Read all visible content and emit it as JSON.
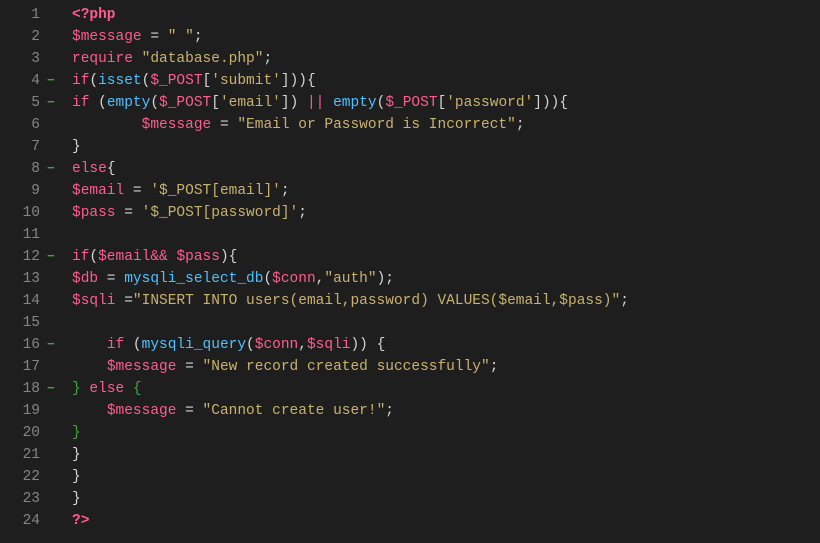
{
  "lines": [
    {
      "n": "1",
      "fold": "",
      "tokens": [
        {
          "c": "t-tag",
          "t": "<?php"
        }
      ]
    },
    {
      "n": "2",
      "fold": "",
      "tokens": [
        {
          "c": "t-var",
          "t": "$message"
        },
        {
          "c": "t-op",
          "t": " = "
        },
        {
          "c": "t-str",
          "t": "\" \""
        },
        {
          "c": "t-punc",
          "t": ";"
        }
      ]
    },
    {
      "n": "3",
      "fold": "",
      "tokens": [
        {
          "c": "t-kw",
          "t": "require"
        },
        {
          "c": "t-op",
          "t": " "
        },
        {
          "c": "t-str",
          "t": "\"database.php\""
        },
        {
          "c": "t-punc",
          "t": ";"
        }
      ]
    },
    {
      "n": "4",
      "fold": "−",
      "tokens": [
        {
          "c": "t-kw",
          "t": "if"
        },
        {
          "c": "t-punc",
          "t": "("
        },
        {
          "c": "t-fn",
          "t": "isset"
        },
        {
          "c": "t-punc",
          "t": "("
        },
        {
          "c": "t-var",
          "t": "$_POST"
        },
        {
          "c": "t-punc",
          "t": "["
        },
        {
          "c": "t-str",
          "t": "'submit'"
        },
        {
          "c": "t-punc",
          "t": "])){"
        }
      ]
    },
    {
      "n": "5",
      "fold": "−",
      "tokens": [
        {
          "c": "t-kw",
          "t": "if"
        },
        {
          "c": "t-punc",
          "t": " ("
        },
        {
          "c": "t-fn",
          "t": "empty"
        },
        {
          "c": "t-punc",
          "t": "("
        },
        {
          "c": "t-var",
          "t": "$_POST"
        },
        {
          "c": "t-punc",
          "t": "["
        },
        {
          "c": "t-str",
          "t": "'email'"
        },
        {
          "c": "t-punc",
          "t": "]) "
        },
        {
          "c": "t-kw",
          "t": "||"
        },
        {
          "c": "t-punc",
          "t": " "
        },
        {
          "c": "t-fn",
          "t": "empty"
        },
        {
          "c": "t-punc",
          "t": "("
        },
        {
          "c": "t-var",
          "t": "$_POST"
        },
        {
          "c": "t-punc",
          "t": "["
        },
        {
          "c": "t-str",
          "t": "'password'"
        },
        {
          "c": "t-punc",
          "t": "])){"
        }
      ]
    },
    {
      "n": "6",
      "fold": "",
      "tokens": [
        {
          "c": "t-op",
          "t": "        "
        },
        {
          "c": "t-var",
          "t": "$message"
        },
        {
          "c": "t-op",
          "t": " = "
        },
        {
          "c": "t-str",
          "t": "\"Email or Password is Incorrect\""
        },
        {
          "c": "t-punc",
          "t": ";"
        }
      ]
    },
    {
      "n": "7",
      "fold": "",
      "tokens": [
        {
          "c": "t-punc",
          "t": "}"
        }
      ]
    },
    {
      "n": "8",
      "fold": "−",
      "tokens": [
        {
          "c": "t-kw",
          "t": "else"
        },
        {
          "c": "t-punc",
          "t": "{"
        }
      ]
    },
    {
      "n": "9",
      "fold": "",
      "tokens": [
        {
          "c": "t-var",
          "t": "$email"
        },
        {
          "c": "t-op",
          "t": " = "
        },
        {
          "c": "t-str",
          "t": "'$_POST[email]'"
        },
        {
          "c": "t-punc",
          "t": ";"
        }
      ]
    },
    {
      "n": "10",
      "fold": "",
      "tokens": [
        {
          "c": "t-var",
          "t": "$pass"
        },
        {
          "c": "t-op",
          "t": " = "
        },
        {
          "c": "t-str",
          "t": "'$_POST[password]'"
        },
        {
          "c": "t-punc",
          "t": ";"
        }
      ]
    },
    {
      "n": "11",
      "fold": "",
      "tokens": []
    },
    {
      "n": "12",
      "fold": "−",
      "tokens": [
        {
          "c": "t-kw",
          "t": "if"
        },
        {
          "c": "t-punc",
          "t": "("
        },
        {
          "c": "t-var",
          "t": "$email"
        },
        {
          "c": "t-kw",
          "t": "&&"
        },
        {
          "c": "t-op",
          "t": " "
        },
        {
          "c": "t-var",
          "t": "$pass"
        },
        {
          "c": "t-punc",
          "t": "){"
        }
      ]
    },
    {
      "n": "13",
      "fold": "",
      "tokens": [
        {
          "c": "t-var",
          "t": "$db"
        },
        {
          "c": "t-op",
          "t": " = "
        },
        {
          "c": "t-fn",
          "t": "mysqli_select_db"
        },
        {
          "c": "t-punc",
          "t": "("
        },
        {
          "c": "t-var",
          "t": "$conn"
        },
        {
          "c": "t-punc",
          "t": ","
        },
        {
          "c": "t-str",
          "t": "\"auth\""
        },
        {
          "c": "t-punc",
          "t": ");"
        }
      ]
    },
    {
      "n": "14",
      "fold": "",
      "tokens": [
        {
          "c": "t-var",
          "t": "$sqli"
        },
        {
          "c": "t-op",
          "t": " ="
        },
        {
          "c": "t-str",
          "t": "\"INSERT INTO users(email,password) VALUES($email,$pass)\""
        },
        {
          "c": "t-punc",
          "t": ";"
        }
      ]
    },
    {
      "n": "15",
      "fold": "",
      "tokens": []
    },
    {
      "n": "16",
      "fold": "−",
      "tokens": [
        {
          "c": "t-op",
          "t": "    "
        },
        {
          "c": "t-kw",
          "t": "if"
        },
        {
          "c": "t-punc",
          "t": " ("
        },
        {
          "c": "t-fn",
          "t": "mysqli_query"
        },
        {
          "c": "t-punc",
          "t": "("
        },
        {
          "c": "t-var",
          "t": "$conn"
        },
        {
          "c": "t-punc",
          "t": ","
        },
        {
          "c": "t-var",
          "t": "$sqli"
        },
        {
          "c": "t-punc",
          "t": ")) {"
        }
      ]
    },
    {
      "n": "17",
      "fold": "",
      "tokens": [
        {
          "c": "t-op",
          "t": "    "
        },
        {
          "c": "t-var",
          "t": "$message"
        },
        {
          "c": "t-op",
          "t": " = "
        },
        {
          "c": "t-str",
          "t": "\"New record created successfully\""
        },
        {
          "c": "t-punc",
          "t": ";"
        }
      ]
    },
    {
      "n": "18",
      "fold": "−",
      "tokens": [
        {
          "c": "t-fold",
          "t": "}"
        },
        {
          "c": "t-op",
          "t": " "
        },
        {
          "c": "t-kw",
          "t": "else"
        },
        {
          "c": "t-op",
          "t": " "
        },
        {
          "c": "t-fold",
          "t": "{"
        }
      ]
    },
    {
      "n": "19",
      "fold": "",
      "tokens": [
        {
          "c": "t-op",
          "t": "    "
        },
        {
          "c": "t-var",
          "t": "$message"
        },
        {
          "c": "t-op",
          "t": " = "
        },
        {
          "c": "t-str",
          "t": "\"Cannot create user!\""
        },
        {
          "c": "t-punc",
          "t": ";"
        }
      ]
    },
    {
      "n": "20",
      "fold": "",
      "tokens": [
        {
          "c": "t-fold",
          "t": "}"
        }
      ]
    },
    {
      "n": "21",
      "fold": "",
      "tokens": [
        {
          "c": "t-punc",
          "t": "}"
        }
      ]
    },
    {
      "n": "22",
      "fold": "",
      "tokens": [
        {
          "c": "t-punc",
          "t": "}"
        }
      ]
    },
    {
      "n": "23",
      "fold": "",
      "tokens": [
        {
          "c": "t-punc",
          "t": "}"
        }
      ]
    },
    {
      "n": "24",
      "fold": "",
      "tokens": [
        {
          "c": "t-tag",
          "t": "?>"
        }
      ]
    }
  ]
}
